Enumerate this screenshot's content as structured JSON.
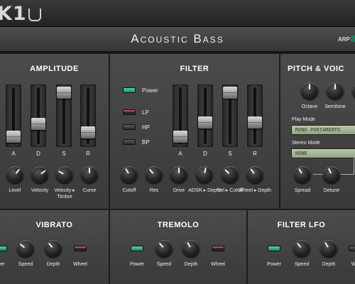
{
  "app": {
    "logo": "K1",
    "patch_name": "Acoustic Bass",
    "arp_label": "ARP"
  },
  "amplitude": {
    "title": "AMPLITUDE",
    "sliders": [
      "A",
      "D",
      "S",
      "R"
    ],
    "knobs": [
      "Level",
      "Velocity",
      "Velocity ▸ Timbre",
      "Curve"
    ]
  },
  "filter": {
    "title": "FILTER",
    "buttons": {
      "power": "Power",
      "lp": "LP",
      "hp": "HP",
      "bp": "BP"
    },
    "sliders": [
      "A",
      "D",
      "S",
      "R"
    ],
    "knobs": [
      "Cutoff",
      "Res",
      "Drive",
      "ADSR ▸ Depth",
      "Vel ▸ Cutoff",
      "Wheel ▸ Depth"
    ]
  },
  "pitch_voice": {
    "title": "PITCH & VOIC",
    "knobs": [
      "Octave",
      "Semitone"
    ],
    "play_mode_label": "Play Mode",
    "play_mode_value": "MONO PORTAMENTO",
    "stereo_mode_label": "Stereo Mode",
    "stereo_mode_value": "NONE",
    "bottom_knobs": [
      "Spread",
      "Detune"
    ]
  },
  "vibrato": {
    "title": "VIBRATO",
    "labels": [
      "wer",
      "Speed",
      "Depth",
      "Wheel"
    ]
  },
  "tremolo": {
    "title": "TREMOLO",
    "labels": [
      "Power",
      "Speed",
      "Depth",
      "Wheel"
    ]
  },
  "filter_lfo": {
    "title": "FILTER LFO",
    "labels": [
      "Power",
      "Speed",
      "Depth",
      "Wh"
    ]
  },
  "colors": {
    "led_green": "#3fc48f",
    "led_red": "#c24d3a",
    "lcd": "#a9b998"
  }
}
